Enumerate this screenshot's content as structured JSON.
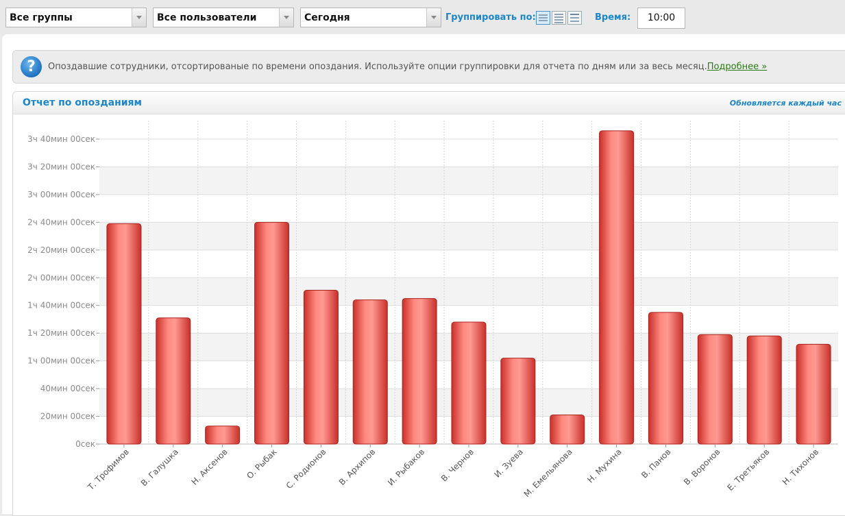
{
  "filters": {
    "group": "Все группы",
    "users": "Все пользователи",
    "period": "Сегодня"
  },
  "grouping": {
    "label": "Группировать по:",
    "icons": [
      "group-by-list-icon",
      "group-by-days-icon",
      "group-by-month-icon"
    ]
  },
  "time": {
    "label": "Время:",
    "value": "10:00"
  },
  "info": {
    "icon": "help-icon",
    "text": "Опоздавшие сотрудники, отсортированые по времени опоздания. Используйте опции группировки для отчета по дням или за весь месяц.",
    "link": "Подробнее »"
  },
  "report": {
    "title": "Отчет по опозданиям",
    "note": "Обновляется каждый час"
  },
  "colors": {
    "accent": "#1b86c9",
    "bar": "#e8524a",
    "link": "#2a7b14"
  },
  "chart_data": {
    "type": "bar",
    "unit": "minutes",
    "categories": [
      "Т. Трофимов",
      "В. Галушка",
      "Н. Аксенов",
      "О. Рыбак",
      "С. Родионов",
      "В. Архипов",
      "И. Рыбаков",
      "В. Чернов",
      "И. Зуева",
      "М. Емельянова",
      "Н. Мухина",
      "В. Панов",
      "В. Воронов",
      "Е. Третьяков",
      "Н. Тихонов"
    ],
    "values": [
      159,
      91,
      13,
      160,
      111,
      104,
      105,
      88,
      62,
      21,
      226,
      95,
      79,
      78,
      72
    ],
    "ylim": [
      0,
      230
    ],
    "yticks": [
      0,
      20,
      40,
      60,
      80,
      100,
      120,
      140,
      160,
      180,
      200,
      220
    ],
    "ytick_labels": [
      "0сек",
      "20мин 00сек",
      "40мин 00сек",
      "1ч 00мин 00сек",
      "1ч 20мин 00сек",
      "1ч 40мин 00сек",
      "2ч 00мин 00сек",
      "2ч 20мин 00сек",
      "2ч 40мин 00сек",
      "3ч 00мин 00сек",
      "3ч 20мин 00сек",
      "3ч 40мин 00сек"
    ],
    "grid": true
  }
}
